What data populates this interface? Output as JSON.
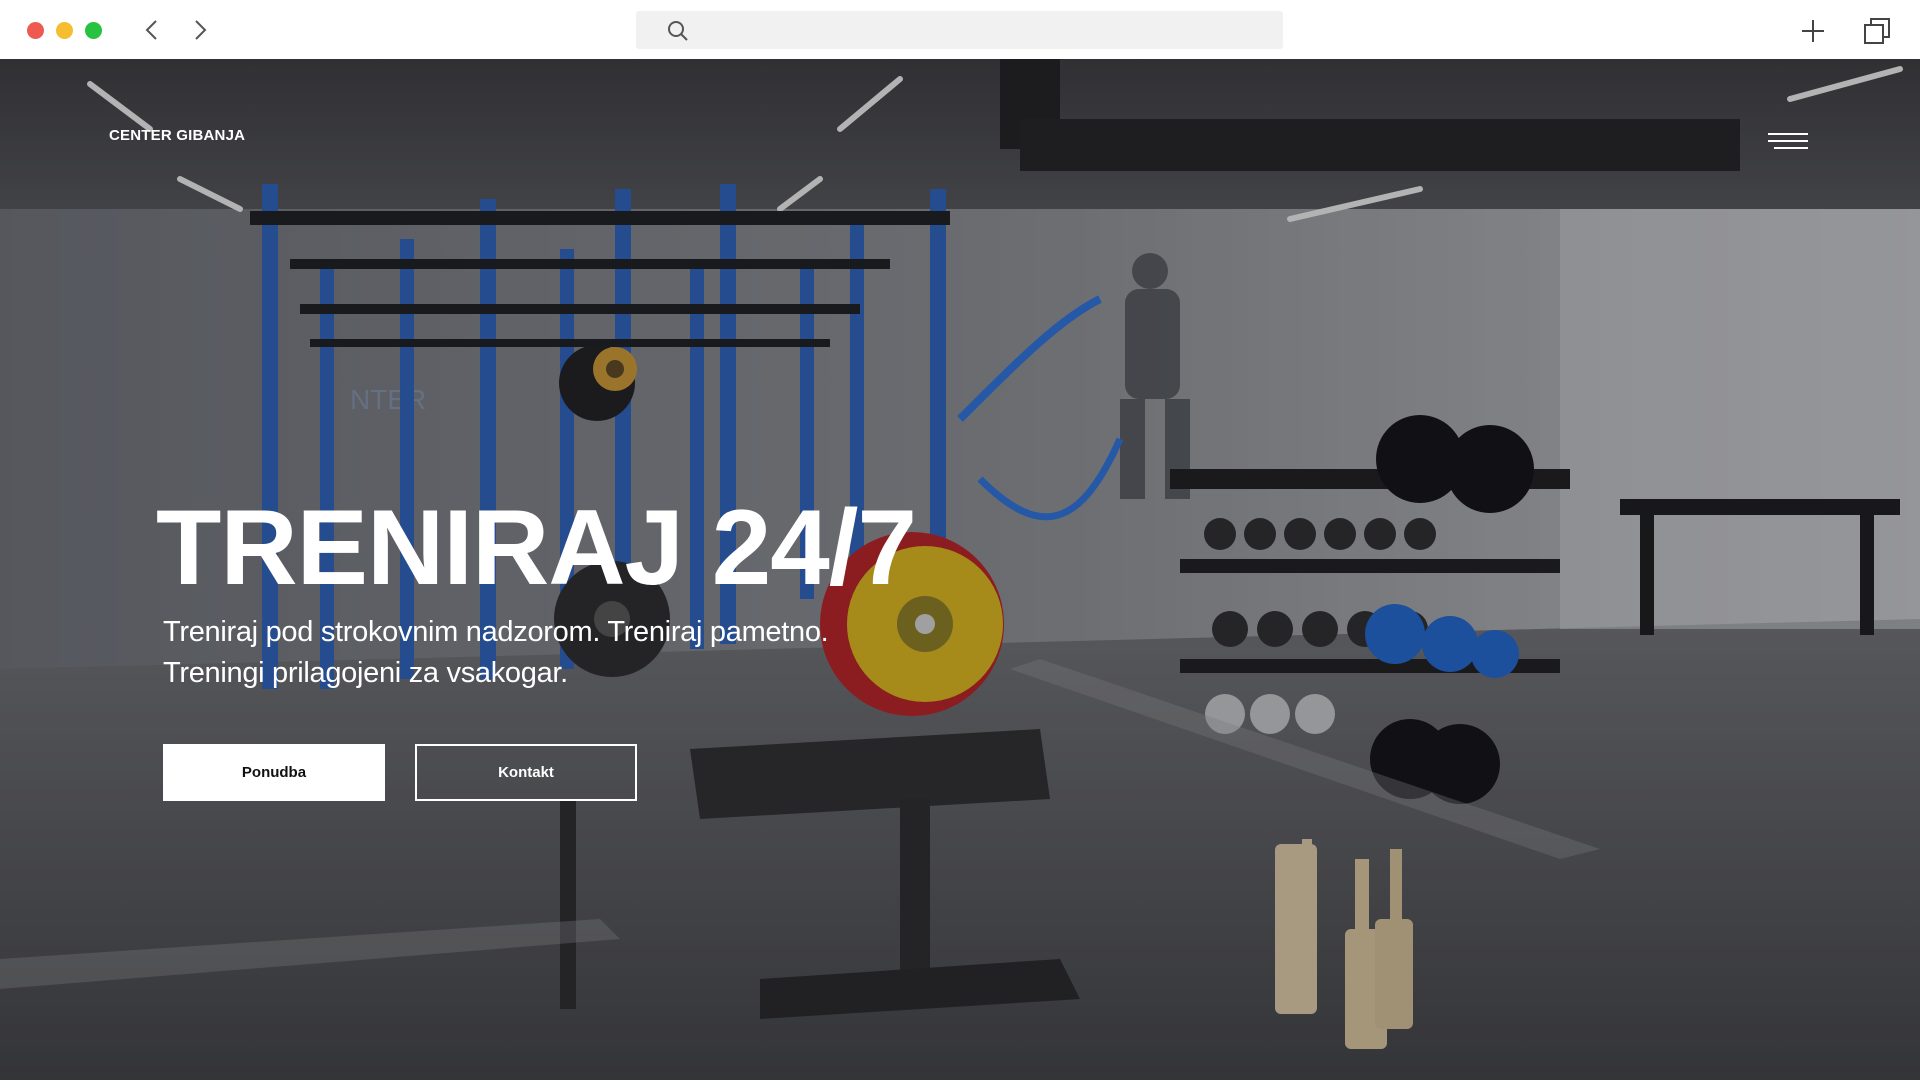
{
  "browser": {
    "address_value": "",
    "icons": {
      "back": "chevron-left-icon",
      "forward": "chevron-right-icon",
      "search": "search-icon",
      "new_tab": "plus-icon",
      "tabs": "tabs-icon"
    },
    "traffic_colors": [
      "#ee5a52",
      "#f5bd2f",
      "#27c23f"
    ]
  },
  "site": {
    "brand": "CENTER GIBANJA",
    "menu_icon": "hamburger-menu-icon"
  },
  "hero": {
    "headline": "TRENIRAJ 24/7",
    "sub_line_1": "Treniraj pod strokovnim nadzorom. Treniraj pametno.",
    "sub_line_2": "Treningi prilagojeni za vsakogar.",
    "primary_button": "Ponudba",
    "secondary_button": "Kontakt",
    "background_image": "gym-interior-photo"
  }
}
